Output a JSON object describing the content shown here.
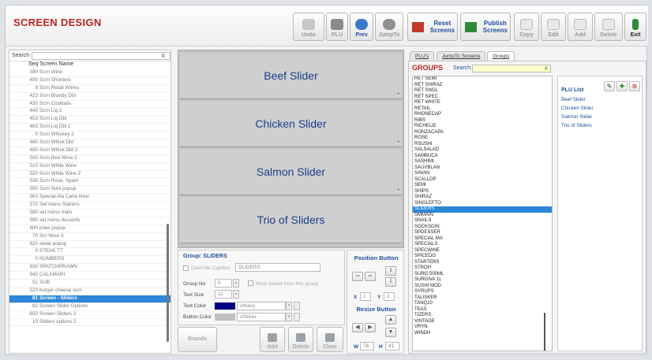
{
  "app": {
    "title": "SCREEN DESIGN"
  },
  "toolbar": {
    "undo": "Undo",
    "plu": "PLU",
    "prev": "Prev",
    "jumpto": "JumpTo",
    "reset": "Reset Screens",
    "publish": "Publish Screens",
    "copy": "Copy",
    "edit": "Edit",
    "add": "Add",
    "delete": "Delete",
    "exit": "Exit"
  },
  "left": {
    "search_label": "Search",
    "search_clear": "X",
    "header": "Seq Screen Name",
    "rows": [
      {
        "seq": "390",
        "name": "Scrn Wine"
      },
      {
        "seq": "400",
        "name": "Scrn Shooters"
      },
      {
        "seq": "9",
        "name": "Scrn Retail Wines"
      },
      {
        "seq": "423",
        "name": "Scrn Brandy Dbl"
      },
      {
        "seq": "430",
        "name": "Scrn Cocktails"
      },
      {
        "seq": "440",
        "name": "Scrn Liq 2"
      },
      {
        "seq": "453",
        "name": "Scrn Liq Dbl"
      },
      {
        "seq": "463",
        "name": "Scrn Liq Dbl 2"
      },
      {
        "seq": "0",
        "name": "Scrn Whiskey 2"
      },
      {
        "seq": "480",
        "name": "Scrn Whisk Dbl"
      },
      {
        "seq": "490",
        "name": "Scrn Whisk Dbl 2"
      },
      {
        "seq": "500",
        "name": "Scrn Red Wine 2"
      },
      {
        "seq": "510",
        "name": "Scrn White Wine"
      },
      {
        "seq": "520",
        "name": "Scrn White Wine 2"
      },
      {
        "seq": "530",
        "name": "Scrn Rose, Spark"
      },
      {
        "seq": "550",
        "name": "Scrn Suhi popup"
      },
      {
        "seq": "563",
        "name": "Special Ala Carte New"
      },
      {
        "seq": "570",
        "name": "Set menu Starters"
      },
      {
        "seq": "580",
        "name": "set menu main"
      },
      {
        "seq": "590",
        "name": "set menu desserts"
      },
      {
        "seq": "600",
        "name": "poke popup"
      },
      {
        "seq": "70",
        "name": "Scr Wise 3"
      },
      {
        "seq": "620",
        "name": "steak popup"
      },
      {
        "seq": "0",
        "name": "STEAK TT"
      },
      {
        "seq": "0",
        "name": "NUMBERS"
      },
      {
        "seq": "630",
        "name": "SPATCHPRAWN"
      },
      {
        "seq": "640",
        "name": "CALAMARI"
      },
      {
        "seq": "51",
        "name": "SUB"
      },
      {
        "seq": "520",
        "name": "burger cheese scrn"
      },
      {
        "seq": "81",
        "name": "Screen - Sliders"
      },
      {
        "seq": "82",
        "name": "Screen Slider Options"
      },
      {
        "seq": "650",
        "name": "Screen Sliders 2"
      },
      {
        "seq": "10",
        "name": "Sliders options 2"
      }
    ],
    "selected_index": 29
  },
  "tiles": [
    "Beef Slider",
    "Chicken Slider",
    "Salmon Slider",
    "Trio of Sliders"
  ],
  "group": {
    "title": "Group:  SLIDERS",
    "override_label": "Override Caption",
    "override_value": "SLIDERS",
    "group_no_label": "Group No",
    "group_no": "0",
    "must_select": "Must Select from this group",
    "text_size_label": "Text Size",
    "text_size": "11",
    "text_color_label": "Text Color",
    "text_color_name": "clNavy",
    "text_color": "#000080",
    "button_color_label": "Button Color",
    "button_color_name": "clSilver",
    "button_color": "#c0c0c0"
  },
  "position": {
    "title": "Position Button",
    "x_label": "X",
    "x": "1",
    "y_label": "Y",
    "y": "2",
    "resize_title": "Resize Button",
    "w_label": "W",
    "w": "76",
    "h_label": "H",
    "h": "41"
  },
  "bottom": {
    "brands": "Brands",
    "add": "Add",
    "delete": "Delete",
    "clear": "Clear"
  },
  "right": {
    "tabs": [
      "PLU's",
      "JumpTo Screens",
      "Groups"
    ],
    "groups_title": "GROUPS",
    "search_label": "Search",
    "search_clear": "X",
    "groups": [
      "RET SEMI",
      "RET SHIRAZ",
      "RET SNGL",
      "RET SPEC",
      "RET WHITE",
      "RETAIL",
      "RHONECAP",
      "RIBS",
      "RICHELIE",
      "RONZACAPA",
      "ROSE",
      "RSUSHI",
      "SALSALAD",
      "SAMBUCA",
      "SASHIMI",
      "SAUVBLAN",
      "SAVAN",
      "SCALLOP",
      "SEMI",
      "SHIPS",
      "SHIRAZ",
      "SINGLEFTO",
      "SLIDERS",
      "SMMAIN",
      "SNAILS",
      "SOCKSGIN",
      "SPDESSER",
      "SPECIAL MA",
      "SPECIALS",
      "SPECWINE",
      "SPICEDG",
      "STARTERS",
      "STROH",
      "SURG 500ML",
      "SURGIVA 1L",
      "SUSHI MOD",
      "SYRUPS",
      "TALISKER",
      "TANQ10",
      "TEAS",
      "TIZERS",
      "VINTAGE",
      "VRYN",
      "WINDH"
    ],
    "selected_group": 22,
    "plu_title": "PLU List",
    "plu_items": [
      "Beef Slider",
      "Chicken Slider",
      "Salmon Slider",
      "Trio of Sliders"
    ]
  }
}
